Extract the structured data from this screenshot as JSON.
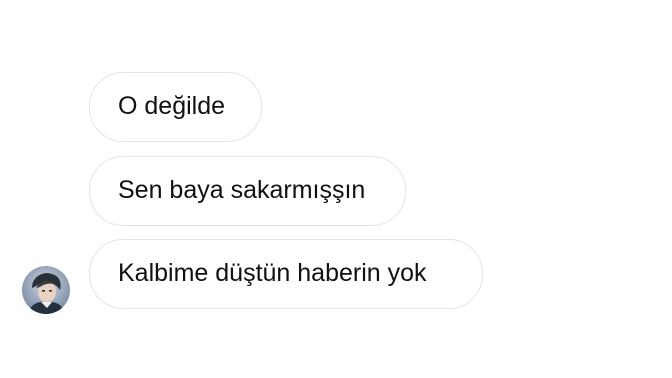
{
  "conversation": {
    "messages": [
      {
        "text": "O değilde"
      },
      {
        "text": "Sen baya sakarmışşın"
      },
      {
        "text": "Kalbime düştün haberin yok"
      }
    ],
    "sender_avatar": {
      "icon": "profile-photo-avatar"
    }
  }
}
